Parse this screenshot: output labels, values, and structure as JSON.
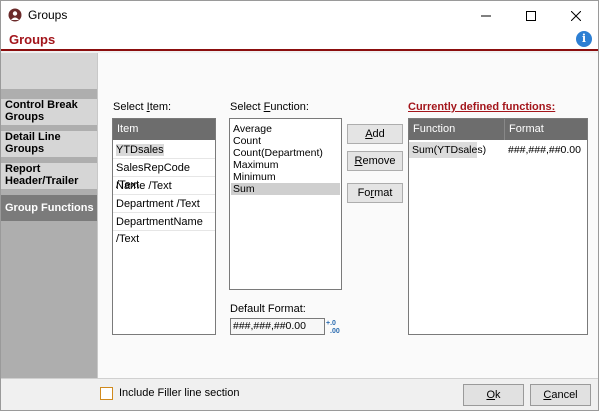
{
  "window": {
    "title": "Groups"
  },
  "header": {
    "title": "Groups"
  },
  "nav": {
    "items": [
      {
        "label": "Control Break Groups"
      },
      {
        "label": "Detail Line Groups"
      },
      {
        "label": "Report Header/Trailer"
      },
      {
        "label": "Group Functions"
      }
    ]
  },
  "item_section": {
    "label_pre": "Select ",
    "label_key": "I",
    "label_post": "tem:",
    "header": "Item",
    "items": [
      "YTDsales",
      "SalesRepCode /Text",
      "Name /Text",
      "Department /Text",
      "DepartmentName /Text"
    ],
    "selected": "YTDsales"
  },
  "function_section": {
    "label_pre": "Select ",
    "label_key": "F",
    "label_post": "unction:",
    "items": [
      "Average",
      "Count",
      "Count(Department)",
      "Maximum",
      "Minimum",
      "Sum"
    ],
    "selected": "Sum"
  },
  "buttons": {
    "add_pre": "",
    "add_key": "A",
    "add_post": "dd",
    "remove_pre": "",
    "remove_key": "R",
    "remove_post": "emove",
    "format_pre": "Fo",
    "format_key": "r",
    "format_post": "mat"
  },
  "default_format": {
    "label": "Default Format:",
    "value": "###,###,##0.00"
  },
  "defined": {
    "title": "Currently defined functions:",
    "columns": [
      "Function",
      "Format"
    ],
    "rows": [
      {
        "function": "Sum(YTDsales)",
        "format": "###,###,##0.00"
      }
    ]
  },
  "footer": {
    "checkbox_label": "Include Filler line section",
    "ok_pre": "",
    "ok_key": "O",
    "ok_post": "k",
    "cancel_pre": "",
    "cancel_key": "C",
    "cancel_post": "ancel"
  },
  "colors": {
    "accent": "#a3151b",
    "header_line": "#8b0e0e",
    "list_header": "#6d6d6d",
    "nav_active": "#7b7b7b"
  }
}
